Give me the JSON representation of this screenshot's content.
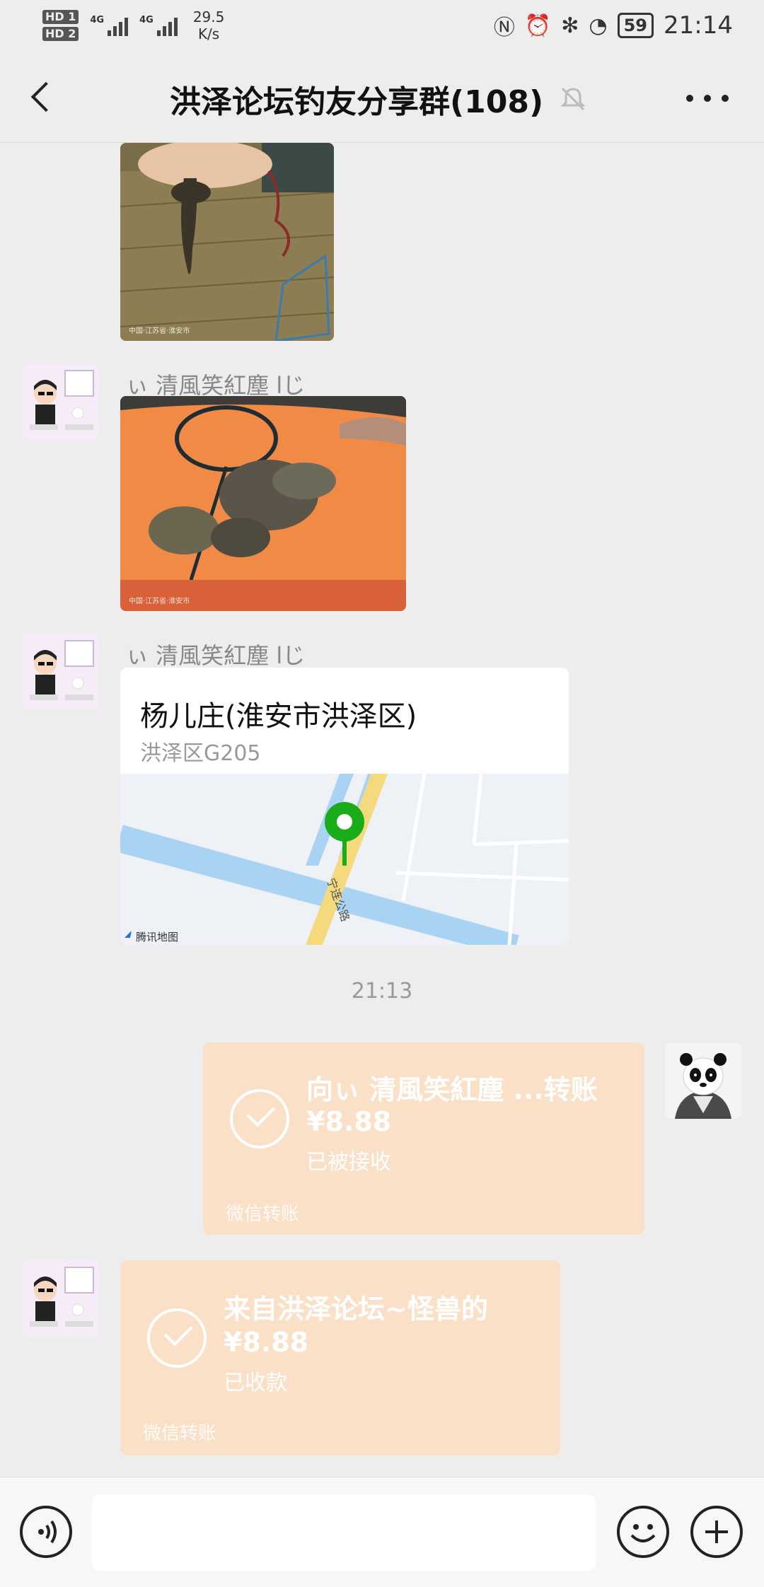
{
  "status_bar": {
    "sim1": "HD 1",
    "sim2": "HD 2",
    "net1": "4G",
    "net2": "4G",
    "speed_value": "29.5",
    "speed_unit": "K/s",
    "battery": "59",
    "time": "21:14"
  },
  "header": {
    "title": "洪泽论坛钓友分享群(108)"
  },
  "messages": {
    "sender_name_1": "ぃ 清風笑紅塵 lじ",
    "sender_name_2": "ぃ 清風笑紅塵 lじ",
    "image_caption_1": "中国·江苏省·淮安市",
    "image_caption_2": "中国·江苏省·淮安市",
    "location": {
      "name": "杨儿庄(淮安市洪泽区)",
      "address": "洪泽区G205",
      "road_label": "宁连公路",
      "map_provider": "腾讯地图"
    },
    "time_separator": "21:13",
    "sent_transfer": {
      "title": "向ぃ 清風笑紅塵 ...转账",
      "amount": "¥8.88",
      "status": "已被接收",
      "footer": "微信转账"
    },
    "received_transfer": {
      "title": "来自洪泽论坛~怪兽的",
      "amount": "¥8.88",
      "status": "已收款",
      "footer": "微信转账"
    }
  },
  "input": {
    "value": ""
  },
  "colors": {
    "background": "#ededed",
    "transfer_bubble": "#fbe0c8",
    "map_pin": "#1aad19"
  }
}
